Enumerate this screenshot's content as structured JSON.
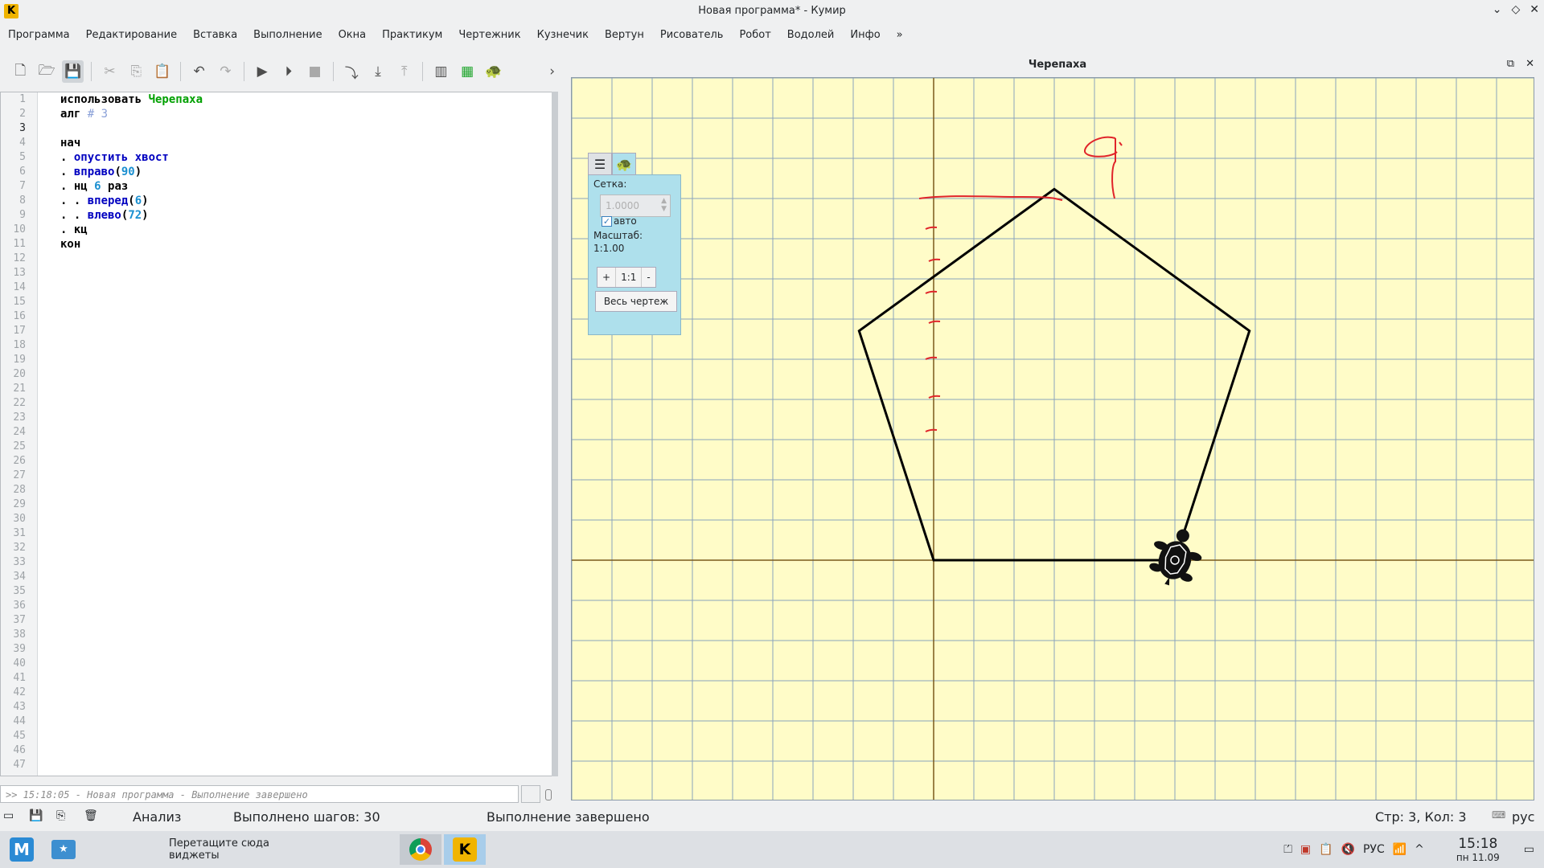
{
  "window": {
    "title": "Новая программа* - Кумир"
  },
  "menu": [
    "Программа",
    "Редактирование",
    "Вставка",
    "Выполнение",
    "Окна",
    "Практикум",
    "Чертежник",
    "Кузнечик",
    "Вертун",
    "Рисователь",
    "Робот",
    "Водолей",
    "Инфо",
    "»"
  ],
  "toolbar": {
    "icons": [
      "new-file-icon",
      "open-folder-icon",
      "save-icon",
      "cut-icon",
      "copy-icon",
      "paste-icon",
      "undo-icon",
      "redo-icon",
      "run-icon",
      "step-run-icon",
      "stop-icon",
      "step-over-icon",
      "step-into-icon",
      "step-out-icon",
      "variables-icon",
      "grid-icon",
      "turtle-icon",
      "more-icon"
    ]
  },
  "editor": {
    "line_numbers": [
      "1",
      "2",
      "3",
      "4",
      "5",
      "6",
      "7",
      "8",
      "9",
      "10",
      "11",
      "12",
      "13",
      "14",
      "15",
      "16",
      "17",
      "18",
      "19",
      "20",
      "21",
      "22",
      "23",
      "24",
      "25",
      "26",
      "27",
      "28",
      "29",
      "30",
      "31",
      "32",
      "33",
      "34",
      "35",
      "36",
      "37",
      "38",
      "39",
      "40",
      "41",
      "42",
      "43",
      "44",
      "45",
      "46",
      "47"
    ],
    "code": [
      [
        {
          "t": "использовать ",
          "c": "kw"
        },
        {
          "t": "Черепаха",
          "c": "grn"
        }
      ],
      [
        {
          "t": "алг ",
          "c": "kw"
        },
        {
          "t": "# 3",
          "c": "cmt"
        }
      ],
      [],
      [
        {
          "t": "нач",
          "c": "kw"
        }
      ],
      [
        {
          "t": ". ",
          "c": "kw"
        },
        {
          "t": "опустить хвост",
          "c": "fn"
        }
      ],
      [
        {
          "t": ". ",
          "c": "kw"
        },
        {
          "t": "вправо",
          "c": "fn"
        },
        {
          "t": "(",
          "c": "kw"
        },
        {
          "t": "90",
          "c": "num"
        },
        {
          "t": ")",
          "c": "kw"
        }
      ],
      [
        {
          "t": ". нц ",
          "c": "kw"
        },
        {
          "t": "6",
          "c": "num"
        },
        {
          "t": " раз",
          "c": "kw"
        }
      ],
      [
        {
          "t": ". . ",
          "c": "kw"
        },
        {
          "t": "вперед",
          "c": "fn"
        },
        {
          "t": "(",
          "c": "kw"
        },
        {
          "t": "6",
          "c": "num"
        },
        {
          "t": ")",
          "c": "kw"
        }
      ],
      [
        {
          "t": ". . ",
          "c": "kw"
        },
        {
          "t": "влево",
          "c": "fn"
        },
        {
          "t": "(",
          "c": "kw"
        },
        {
          "t": "72",
          "c": "num"
        },
        {
          "t": ")",
          "c": "kw"
        }
      ],
      [
        {
          "t": ". кц",
          "c": "kw"
        }
      ],
      [
        {
          "t": "кон",
          "c": "kw"
        }
      ]
    ]
  },
  "console": {
    "text": ">> 15:18:05 - Новая программа - Выполнение завершено"
  },
  "status": {
    "mode": "Анализ",
    "steps": "Выполнено шагов: 30",
    "state": "Выполнение завершено",
    "cursor": "Стр: 3, Кол: 3",
    "lang": "рус"
  },
  "turtle": {
    "title": "Черепаха",
    "grid_label": "Сетка:",
    "grid_value": "1.0000",
    "auto_label": "авто",
    "scale_label": "Масштаб:",
    "scale_value": "1:1.00",
    "zoom_plus": "+",
    "zoom_reset": "1:1",
    "zoom_minus": "-",
    "whole_drawing": "Весь чертеж"
  },
  "taskbar": {
    "widget_hint": "Перетащите сюда виджеты",
    "lang": "РУС",
    "time": "15:18",
    "date": "пн 11.09"
  }
}
